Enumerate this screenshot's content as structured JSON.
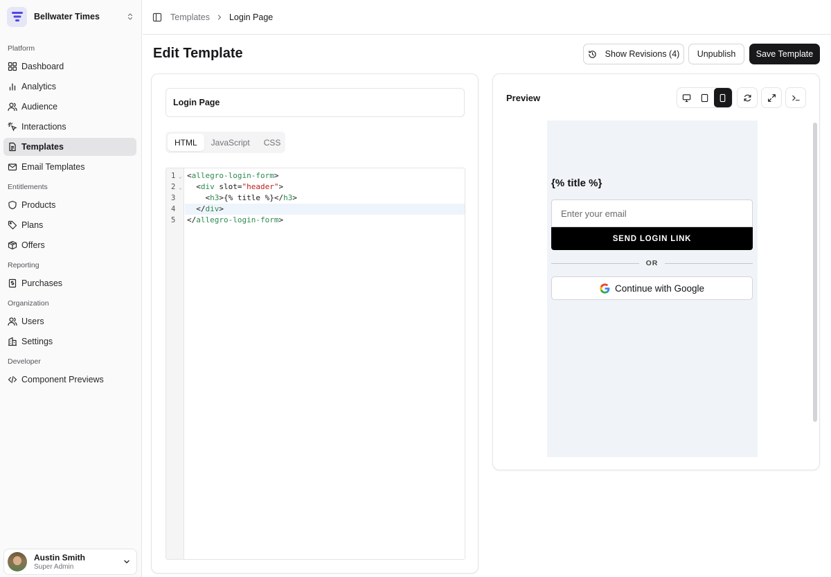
{
  "org": {
    "name": "Bellwater Times"
  },
  "sidebar": {
    "sections": [
      {
        "label": "Platform"
      },
      {
        "label": "Entitlements"
      },
      {
        "label": "Reporting"
      },
      {
        "label": "Organization"
      },
      {
        "label": "Developer"
      }
    ],
    "items": [
      {
        "label": "Dashboard",
        "icon": "dashboard-icon"
      },
      {
        "label": "Analytics",
        "icon": "analytics-icon"
      },
      {
        "label": "Audience",
        "icon": "audience-icon"
      },
      {
        "label": "Interactions",
        "icon": "interactions-icon"
      },
      {
        "label": "Templates",
        "icon": "templates-icon",
        "active": true
      },
      {
        "label": "Email Templates",
        "icon": "mail-icon"
      },
      {
        "label": "Products",
        "icon": "shield-icon"
      },
      {
        "label": "Plans",
        "icon": "tag-icon"
      },
      {
        "label": "Offers",
        "icon": "package-icon"
      },
      {
        "label": "Purchases",
        "icon": "receipt-icon"
      },
      {
        "label": "Users",
        "icon": "users-icon"
      },
      {
        "label": "Settings",
        "icon": "building-icon"
      },
      {
        "label": "Component Previews",
        "icon": "code-icon"
      }
    ],
    "user": {
      "name": "Austin Smith",
      "role": "Super Admin"
    }
  },
  "breadcrumb": {
    "parent": "Templates",
    "current": "Login Page"
  },
  "page": {
    "title": "Edit Template",
    "show_revisions": "Show Revisions (4)",
    "unpublish": "Unpublish",
    "save": "Save Template"
  },
  "editor": {
    "name_value": "Login Page",
    "tabs": [
      "HTML",
      "JavaScript",
      "CSS"
    ],
    "active_tab": "HTML",
    "line_numbers": [
      "1",
      "2",
      "3",
      "4",
      "5"
    ],
    "active_line": 4
  },
  "preview": {
    "title": "Preview",
    "device_selected": "mobile",
    "heading": "{% title %}",
    "email_placeholder": "Enter your email",
    "send_button": "SEND LOGIN LINK",
    "divider": "OR",
    "google_button": "Continue with Google"
  },
  "colors": {
    "accent": "#18181b",
    "tag": "#2d8a4e",
    "string": "#b91c1c",
    "frame_bg": "#f0f3f7"
  }
}
